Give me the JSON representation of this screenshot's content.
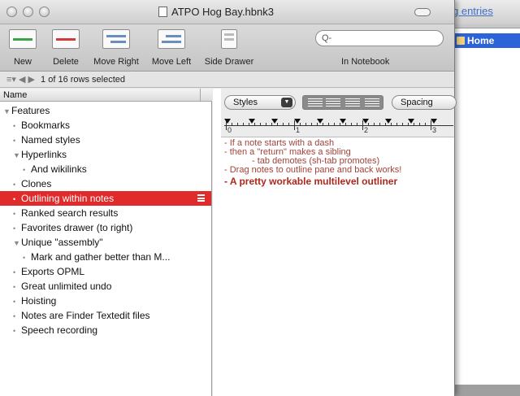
{
  "background_window": {
    "title_fragment": "g entries",
    "sidebar_item": "Home"
  },
  "window": {
    "title": "ATPO Hog Bay.hbnk3"
  },
  "toolbar": {
    "new_label": "New",
    "delete_label": "Delete",
    "move_right_label": "Move Right",
    "move_left_label": "Move Left",
    "side_drawer_label": "Side Drawer",
    "search_placeholder": "Q-",
    "in_notebook_label": "In Notebook"
  },
  "status": {
    "text": "1 of 16 rows selected"
  },
  "outline": {
    "column_header": "Name",
    "rows": [
      {
        "label": "Features",
        "marker": "▼",
        "level": 0
      },
      {
        "label": "Bookmarks",
        "marker": "•",
        "level": 1
      },
      {
        "label": "Named styles",
        "marker": "•",
        "level": 1
      },
      {
        "label": "Hyperlinks",
        "marker": "▼",
        "level": 1
      },
      {
        "label": "And wikilinks",
        "marker": "•",
        "level": 2
      },
      {
        "label": "Clones",
        "marker": "•",
        "level": 1
      },
      {
        "label": "Outlining within notes",
        "marker": "•",
        "level": 1,
        "selected": true
      },
      {
        "label": "Ranked search results",
        "marker": "•",
        "level": 1
      },
      {
        "label": "Favorites drawer (to right)",
        "marker": "•",
        "level": 1
      },
      {
        "label": "Unique \"assembly\"",
        "marker": "▼",
        "level": 1
      },
      {
        "label": "Mark and gather better than M...",
        "marker": "•",
        "level": 2
      },
      {
        "label": "Exports OPML",
        "marker": "•",
        "level": 1
      },
      {
        "label": "Great unlimited undo",
        "marker": "•",
        "level": 1
      },
      {
        "label": "Hoisting",
        "marker": "•",
        "level": 1
      },
      {
        "label": "Notes are Finder Textedit files",
        "marker": "•",
        "level": 1
      },
      {
        "label": "Speech recording",
        "marker": "•",
        "level": 1
      }
    ]
  },
  "editor": {
    "styles_label": "Styles",
    "spacing_label": "Spacing",
    "ruler_numbers": [
      "0",
      "1",
      "2",
      "3"
    ],
    "notes": {
      "line1": "- If a note starts with a dash",
      "line2": "- then a \"return\" makes a sibling",
      "line3": "- tab demotes (sh-tab promotes)",
      "line4": "- Drag notes to outline pane and back works!",
      "line5": "- A pretty workable multilevel outliner"
    }
  },
  "colors": {
    "selection": "#e12a2a",
    "note_text": "#a2433a",
    "accent_blue": "#2d63d8"
  }
}
